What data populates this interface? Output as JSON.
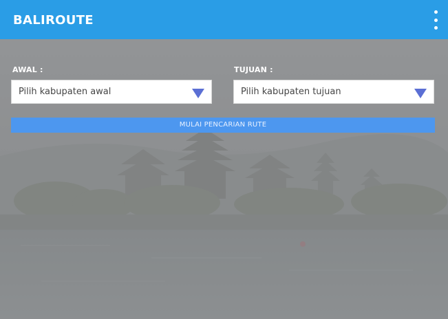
{
  "app": {
    "title": "BALIROUTE"
  },
  "menu": {
    "icon": "more-vert-icon"
  },
  "form": {
    "origin": {
      "label": "AWAL :",
      "selected": "Pilih kabupaten awal"
    },
    "destination": {
      "label": "TUJUAN :",
      "selected": "Pilih kabupaten tujuan"
    },
    "start_label": "MULAI PENCARIAN RUTE"
  },
  "colors": {
    "header": "#2a9de6",
    "button": "#4d97ef",
    "dropdown_arrow": "#5b6fd4",
    "overlay": "#8b8e90"
  }
}
